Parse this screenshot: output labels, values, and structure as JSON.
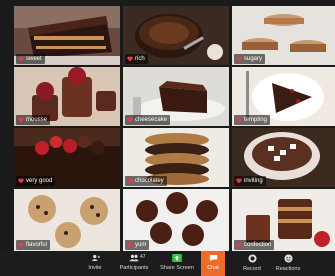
{
  "tiles": [
    {
      "label": "sweet"
    },
    {
      "label": "rich"
    },
    {
      "label": "sugary"
    },
    {
      "label": "mousse"
    },
    {
      "label": "cheesecake"
    },
    {
      "label": "tempting"
    },
    {
      "label": "very good"
    },
    {
      "label": "chocolatey"
    },
    {
      "label": "inviting"
    },
    {
      "label": "flavorful"
    },
    {
      "label": "yum"
    },
    {
      "label": "confection"
    }
  ],
  "toolbar": {
    "invite": "Invite",
    "participants": "Participants",
    "participant_count": "47",
    "share_screen": "Share Screen",
    "chat": "Chat",
    "record": "Record",
    "reactions": "Reactions"
  },
  "colors": {
    "highlight": "#e8ee5a",
    "chat_accent": "#f06b2a",
    "heart": "#e23b4e",
    "share_green": "#3fbf4a"
  }
}
